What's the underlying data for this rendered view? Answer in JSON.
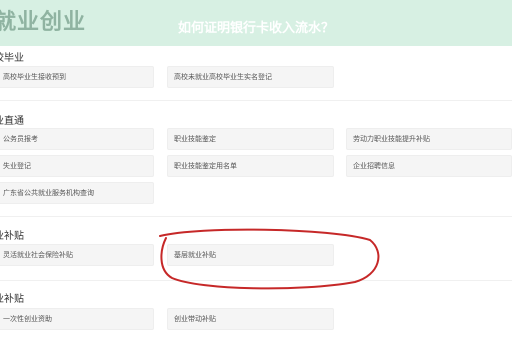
{
  "header": {
    "brand": "就业创业",
    "question": "如何证明银行卡收入流水？"
  },
  "sections": [
    {
      "title": "校毕业",
      "items": [
        "高校毕业生接收预到",
        "高校未就业高校毕业生实名登记"
      ]
    },
    {
      "title": "业直通",
      "items": [
        "公务员报考",
        "职业技能鉴定",
        "劳动力职业技能提升补贴",
        "失业登记",
        "职业技能鉴定用名单",
        "企业招聘信息",
        "广东省公共就业服务机构查询"
      ]
    },
    {
      "title": "业补贴",
      "items": [
        "灵活就业社会保险补贴",
        "基层就业补贴"
      ]
    },
    {
      "title": "业补贴",
      "items": [
        "一次性创业资助",
        "创业带动补贴"
      ]
    }
  ],
  "annotation": {
    "color": "#c62828"
  }
}
